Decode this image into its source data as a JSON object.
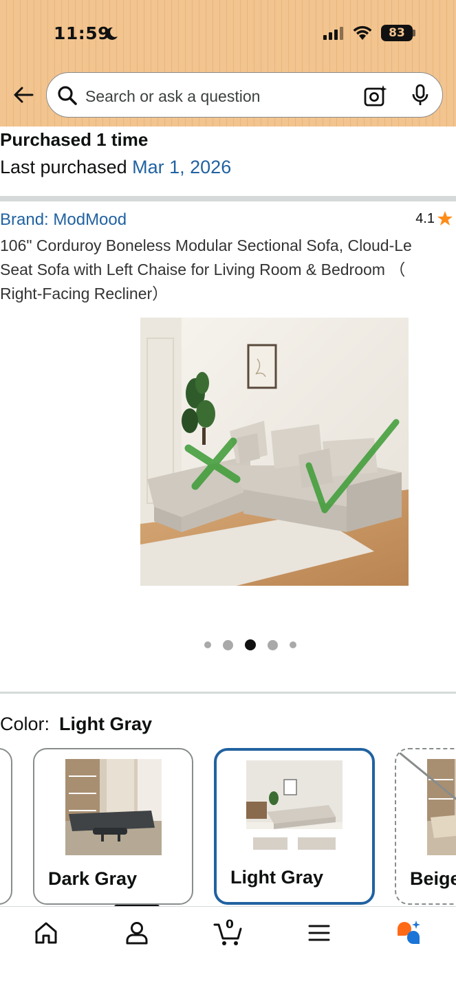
{
  "status_bar": {
    "time": "11:59",
    "battery": "83"
  },
  "search": {
    "placeholder": "Search or ask a question"
  },
  "purchase": {
    "purchased_text": "Purchased 1 time",
    "last_purchased_label": "Last purchased ",
    "last_purchased_date": "Mar 1, 2026"
  },
  "product": {
    "brand": "Brand: ModMood",
    "rating": "4.1",
    "title_line1": "106\" Corduroy Boneless Modular Sectional Sofa, Cloud-Le",
    "title_line2": "Seat Sofa with Left Chaise for Living Room & Bedroom （",
    "title_line3": "Right-Facing Recliner）",
    "image_dots": {
      "total": 5,
      "active_index": 2
    }
  },
  "color": {
    "label": "Color:",
    "selected": "Light Gray",
    "options": [
      {
        "label": "Dark Gray",
        "state": "available"
      },
      {
        "label": "Light Gray",
        "state": "selected"
      },
      {
        "label": "Beige",
        "state": "unavailable"
      }
    ]
  },
  "bottom_nav": {
    "items": [
      "home-icon",
      "account-icon",
      "cart-icon",
      "menu-icon",
      "rufus-icon"
    ],
    "cart_count": "0"
  },
  "colors": {
    "accent_blue": "#2162a1",
    "header_orange": "#f2c48f",
    "star": "#ff8c1a",
    "rufus_orange": "#ff6a16",
    "rufus_blue": "#1c74d6"
  }
}
